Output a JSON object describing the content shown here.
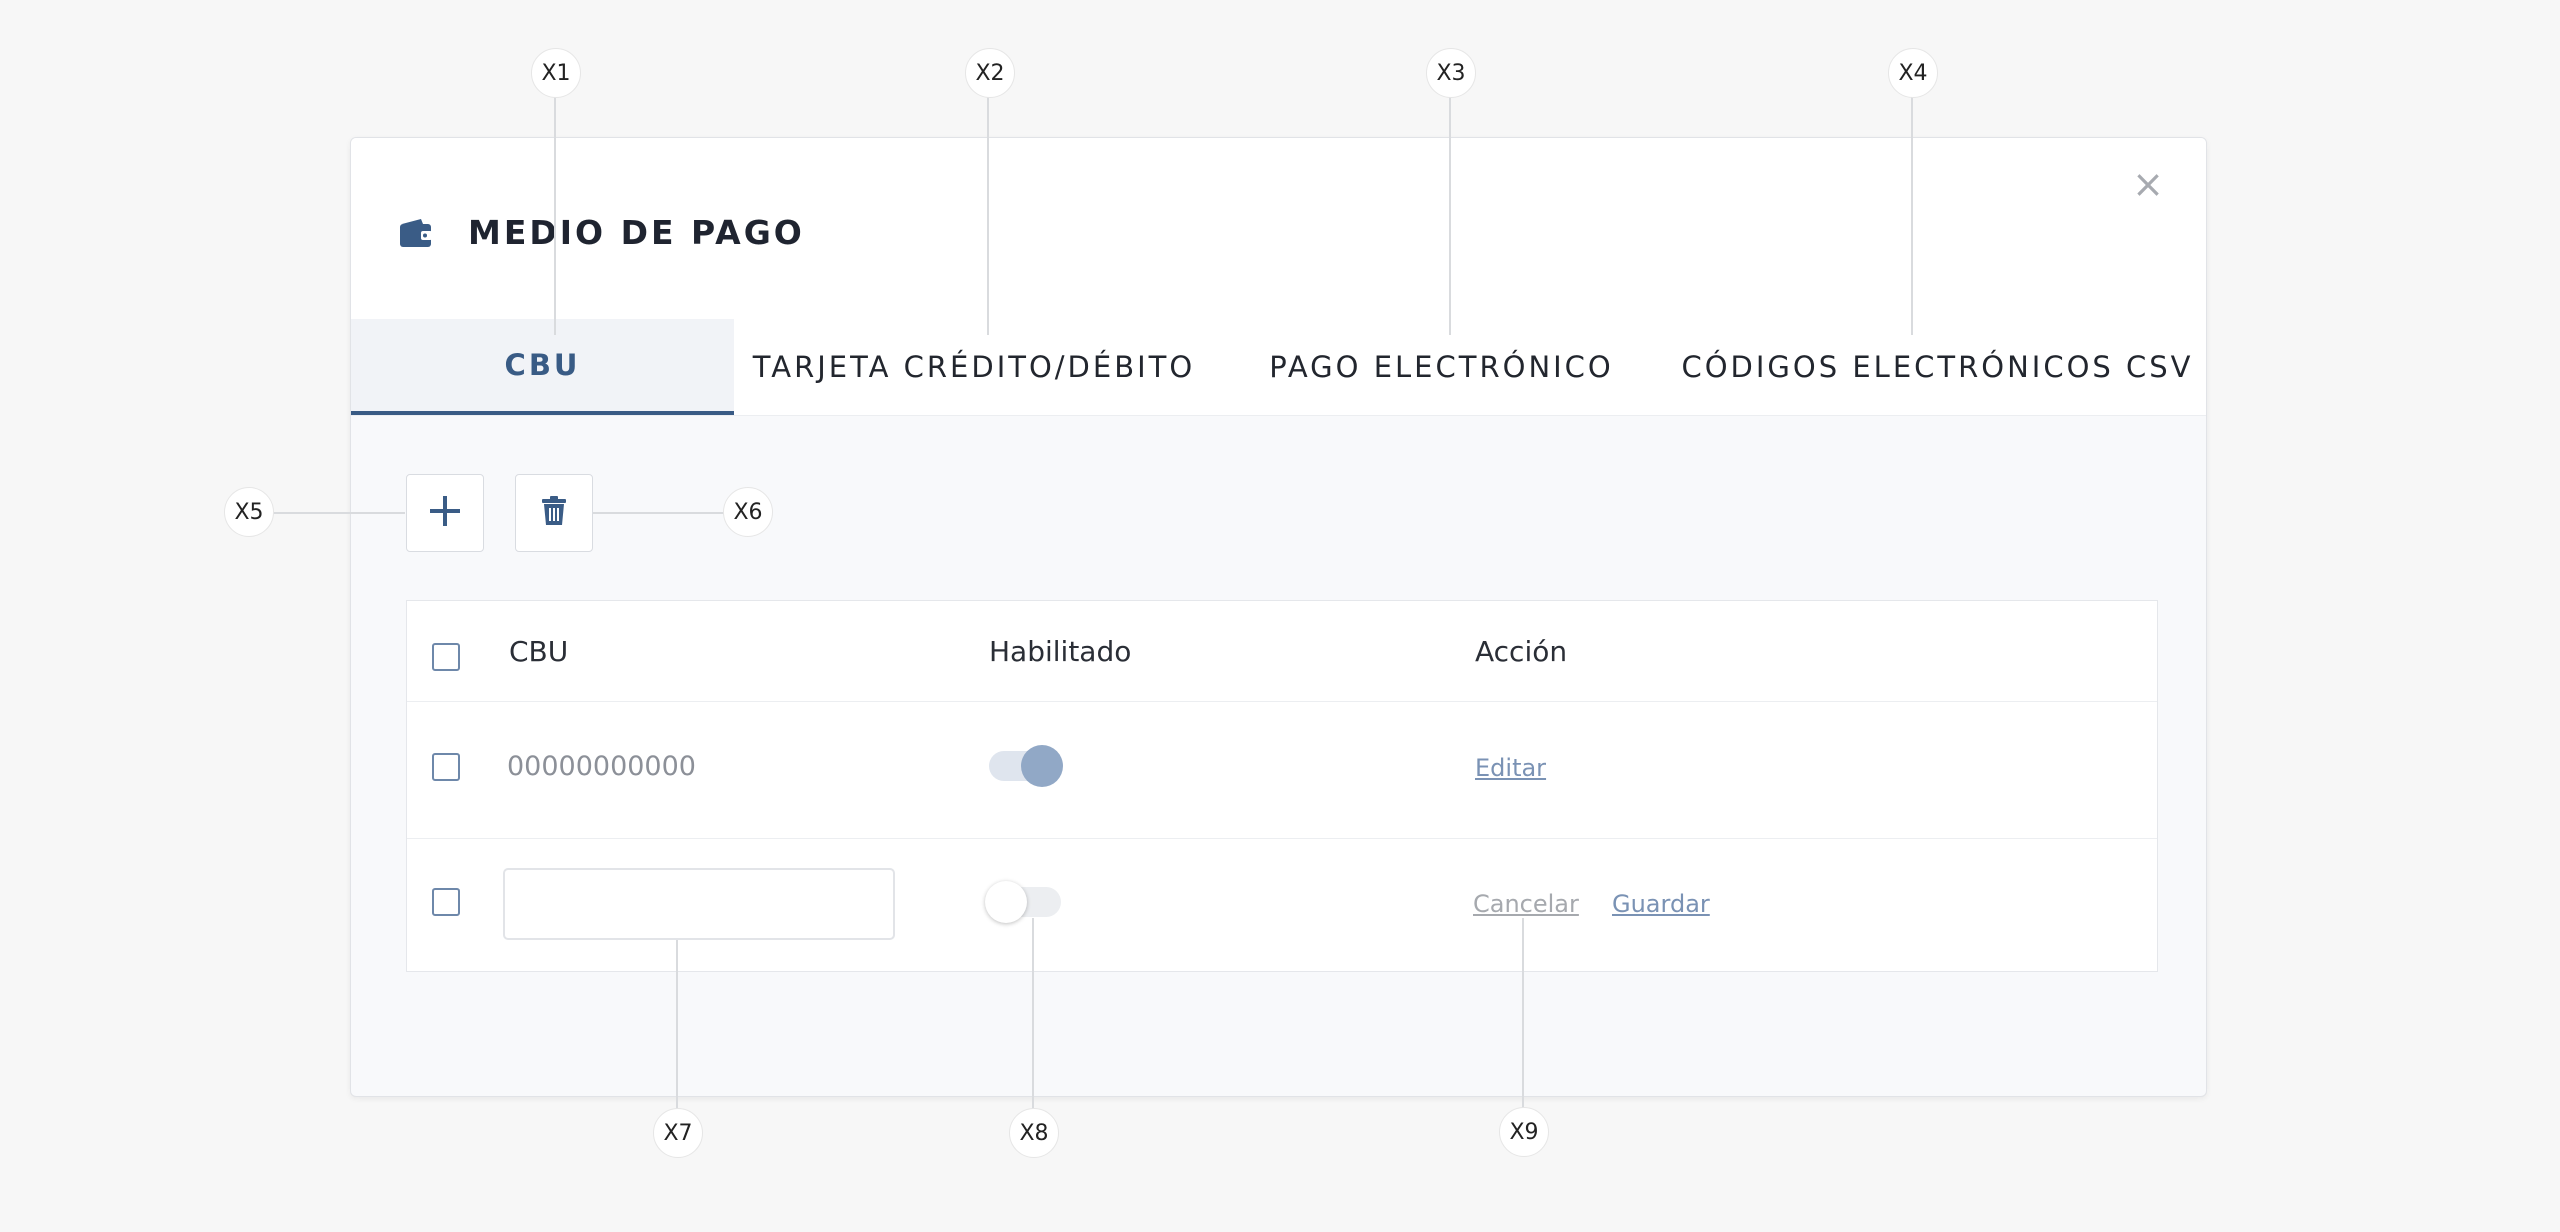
{
  "modal": {
    "title": "MEDIO DE PAGO",
    "close_symbol": "×",
    "header_icon": "wallet-icon"
  },
  "tabs": [
    {
      "label": "CBU",
      "active": true
    },
    {
      "label": "TARJETA CRÉDITO/DÉBITO",
      "active": false
    },
    {
      "label": "PAGO ELECTRÓNICO",
      "active": false
    },
    {
      "label": "CÓDIGOS ELECTRÓNICOS CSV",
      "active": false
    }
  ],
  "toolbar": {
    "add_icon": "plus-icon",
    "delete_icon": "trash-icon"
  },
  "table": {
    "columns": [
      "CBU",
      "Habilitado",
      "Acción"
    ],
    "rows": [
      {
        "cbu": "00000000000",
        "enabled": true,
        "actions": [
          "Editar"
        ]
      },
      {
        "cbu": "",
        "enabled": false,
        "actions": [
          "Cancelar",
          "Guardar"
        ]
      }
    ]
  },
  "callouts": [
    "X1",
    "X2",
    "X3",
    "X4",
    "X5",
    "X6",
    "X7",
    "X8",
    "X9"
  ],
  "colors": {
    "accent": "#395b85",
    "page_background": "#f7f7f7",
    "modal_background": "#f8f9fb",
    "link": "#7a92b4",
    "muted_link": "#a6a9ae"
  }
}
